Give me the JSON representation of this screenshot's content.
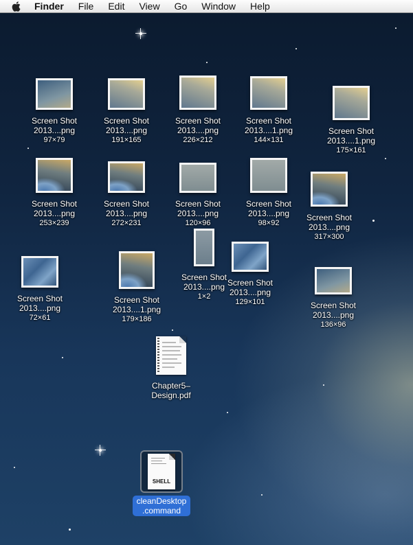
{
  "menubar": {
    "apple_icon": "apple-icon",
    "app_name": "Finder",
    "items": [
      "File",
      "Edit",
      "View",
      "Go",
      "Window",
      "Help"
    ]
  },
  "icons": [
    {
      "line1": "Screen Shot",
      "line2": "2013....png",
      "size": "97×79"
    },
    {
      "line1": "Screen Shot",
      "line2": "2013....png",
      "size": "191×165"
    },
    {
      "line1": "Screen Shot",
      "line2": "2013....png",
      "size": "226×212"
    },
    {
      "line1": "Screen Shot",
      "line2": "2013....1.png",
      "size": "144×131"
    },
    {
      "line1": "Screen Shot",
      "line2": "2013....1.png",
      "size": "175×161"
    },
    {
      "line1": "Screen Shot",
      "line2": "2013....png",
      "size": "253×239"
    },
    {
      "line1": "Screen Shot",
      "line2": "2013....png",
      "size": "272×231"
    },
    {
      "line1": "Screen Shot",
      "line2": "2013....png",
      "size": "120×96"
    },
    {
      "line1": "Screen Shot",
      "line2": "2013....png",
      "size": "98×92"
    },
    {
      "line1": "Screen Shot",
      "line2": "2013....png",
      "size": "317×300"
    },
    {
      "line1": "Screen Shot",
      "line2": "2013....png",
      "size": "72×61"
    },
    {
      "line1": "Screen Shot",
      "line2": "2013....1.png",
      "size": "179×186"
    },
    {
      "line1": "Screen Shot",
      "line2": "2013....png",
      "size": "1×2"
    },
    {
      "line1": "Screen Shot",
      "line2": "2013....png",
      "size": "129×101"
    },
    {
      "line1": "Screen Shot",
      "line2": "2013....png",
      "size": "136×96"
    }
  ],
  "pdf": {
    "line1": "Chapter5–",
    "line2": "Design.pdf"
  },
  "command": {
    "line1": "cleanDesktop",
    "line2": ".command",
    "badge": "SHELL"
  }
}
